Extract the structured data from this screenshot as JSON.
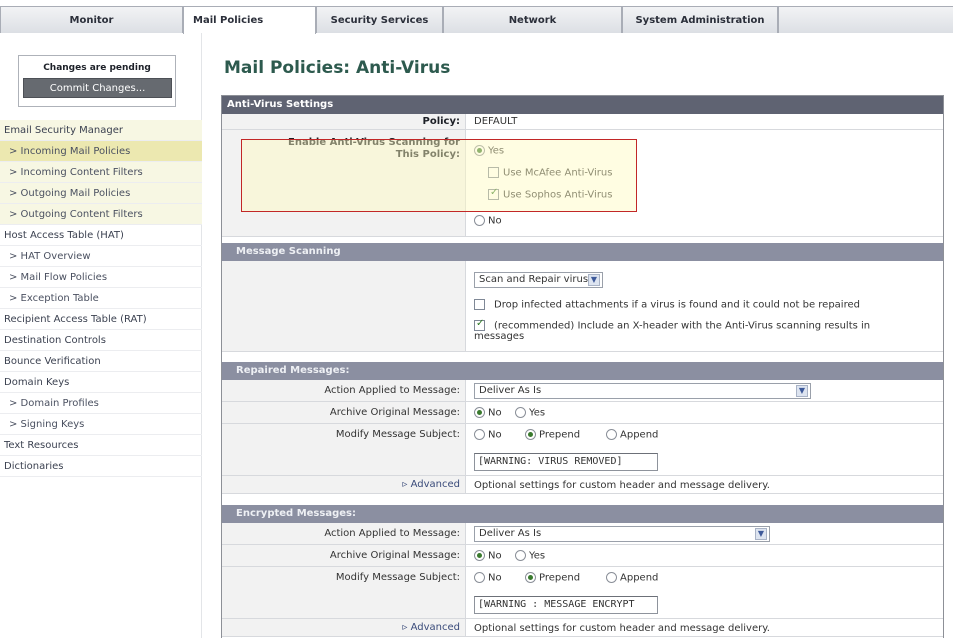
{
  "tabs": [
    "Monitor",
    "Mail Policies",
    "Security Services",
    "Network",
    "System Administration"
  ],
  "sidebar": {
    "pending_text": "Changes are pending",
    "commit_label": "Commit Changes...",
    "items": [
      "Email Security Manager",
      "> Incoming Mail Policies",
      "> Incoming Content Filters",
      "> Outgoing Mail Policies",
      "> Outgoing Content Filters",
      "Host Access Table (HAT)",
      "> HAT Overview",
      "> Mail Flow Policies",
      "> Exception Table",
      "Recipient Access Table (RAT)",
      "Destination Controls",
      "Bounce Verification",
      "Domain Keys",
      "> Domain Profiles",
      "> Signing Keys",
      "Text Resources",
      "Dictionaries"
    ]
  },
  "page_title": "Mail Policies: Anti-Virus",
  "settings": {
    "header": "Anti-Virus Settings",
    "policy_label": "Policy:",
    "policy_value": "DEFAULT",
    "enable_label": "Enable Anti-Virus Scanning for This Policy:",
    "yes": "Yes",
    "mcafee": "Use McAfee Anti-Virus",
    "sophos": "Use Sophos Anti-Virus",
    "no": "No"
  },
  "scanning": {
    "header": "Message Scanning",
    "select": "Scan and Repair viruses",
    "drop": "Drop infected attachments if a virus is found and it could not be repaired",
    "xheader_line1": "(recommended) Include an X-header with the Anti-Virus scanning results in",
    "xheader_line2": "messages"
  },
  "repaired": {
    "header": "Repaired Messages:",
    "action_label": "Action Applied to Message:",
    "action_value": "Deliver As Is",
    "archive_label": "Archive Original Message:",
    "no": "No",
    "yes": "Yes",
    "modify_label": "Modify Message Subject:",
    "prepend": "Prepend",
    "append": "Append",
    "subject_text": "[WARNING: VIRUS REMOVED]",
    "advanced": "▹ Advanced",
    "optional": "Optional settings for custom header and message delivery."
  },
  "encrypted": {
    "header": "Encrypted Messages:",
    "action_label": "Action Applied to Message:",
    "action_value": "Deliver As Is",
    "archive_label": "Archive Original Message:",
    "no": "No",
    "yes": "Yes",
    "modify_label": "Modify Message Subject:",
    "prepend": "Prepend",
    "append": "Append",
    "subject_text": "[WARNING : MESSAGE ENCRYPT",
    "advanced": "▹ Advanced",
    "optional": "Optional settings for custom header and message delivery."
  }
}
